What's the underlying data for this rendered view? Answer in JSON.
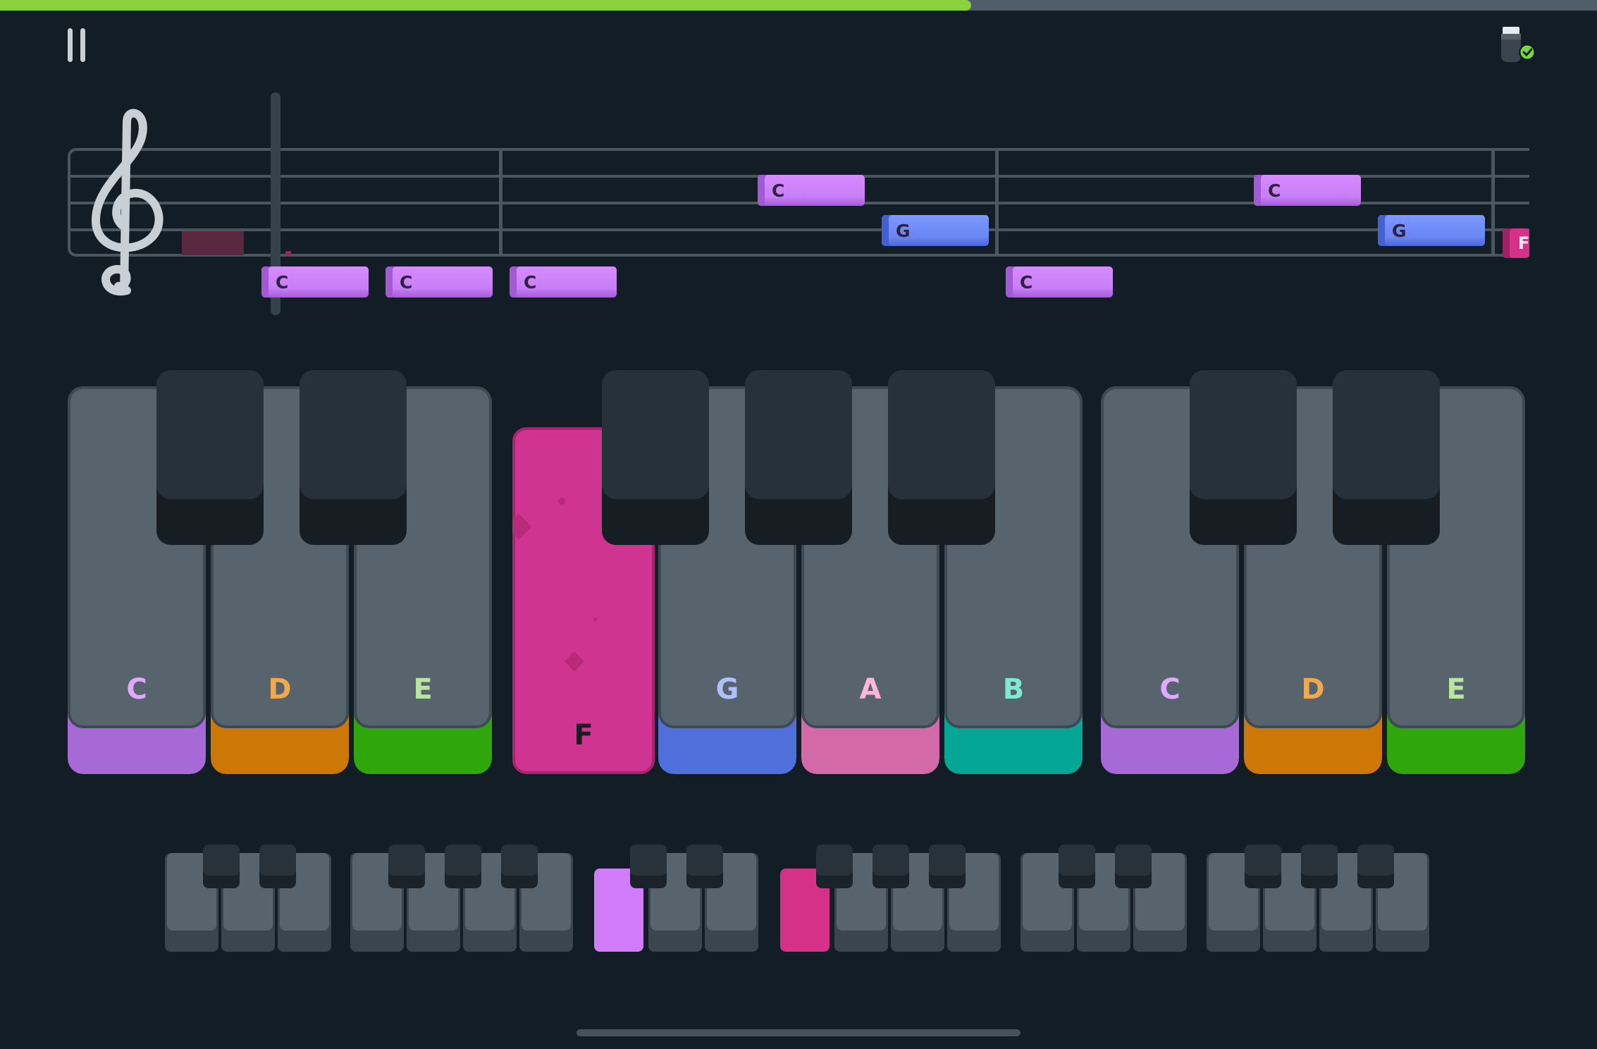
{
  "progress": {
    "fraction": 0.608,
    "fill_color": "#8bd13d",
    "track_color": "#4f5d68"
  },
  "top_bar": {
    "pause_icon": "pause-icon",
    "device_icon": "midi-device-connected-icon"
  },
  "staff": {
    "clef_icon": "treble-clef-icon",
    "notes": [
      {
        "label": "C",
        "color": "purple"
      },
      {
        "label": "C",
        "color": "purple"
      },
      {
        "label": "C",
        "color": "purple"
      },
      {
        "label": "C",
        "color": "purple"
      },
      {
        "label": "G",
        "color": "blue"
      },
      {
        "label": "C",
        "color": "purple"
      },
      {
        "label": "C",
        "color": "purple"
      },
      {
        "label": "G",
        "color": "blue"
      },
      {
        "label": "F",
        "color": "pink"
      }
    ]
  },
  "keyboard": {
    "white_keys": [
      {
        "label": "C",
        "label_color": "#e3a9ff",
        "band_color": "#a769d6"
      },
      {
        "label": "D",
        "label_color": "#f0a94c",
        "band_color": "#cd7706"
      },
      {
        "label": "E",
        "label_color": "#b9e4a2",
        "band_color": "#30a60d"
      },
      {
        "label": "F",
        "label_color": "#1c1c24",
        "band_color": "#cf3490"
      },
      {
        "label": "G",
        "label_color": "#aec0ff",
        "band_color": "#516fdb"
      },
      {
        "label": "A",
        "label_color": "#ffb6dc",
        "band_color": "#d36aa7"
      },
      {
        "label": "B",
        "label_color": "#7eead2",
        "band_color": "#06a696"
      },
      {
        "label": "C",
        "label_color": "#e3a9ff",
        "band_color": "#a769d6"
      },
      {
        "label": "D",
        "label_color": "#f0a94c",
        "band_color": "#cd7706"
      },
      {
        "label": "E",
        "label_color": "#b9e4a2",
        "band_color": "#30a60d"
      }
    ],
    "pressed_key": "F",
    "pressed_color": "#cf3490"
  },
  "mini_keyboard": {
    "highlight_purple": "#d17cf9",
    "highlight_pink": "#d63189"
  }
}
